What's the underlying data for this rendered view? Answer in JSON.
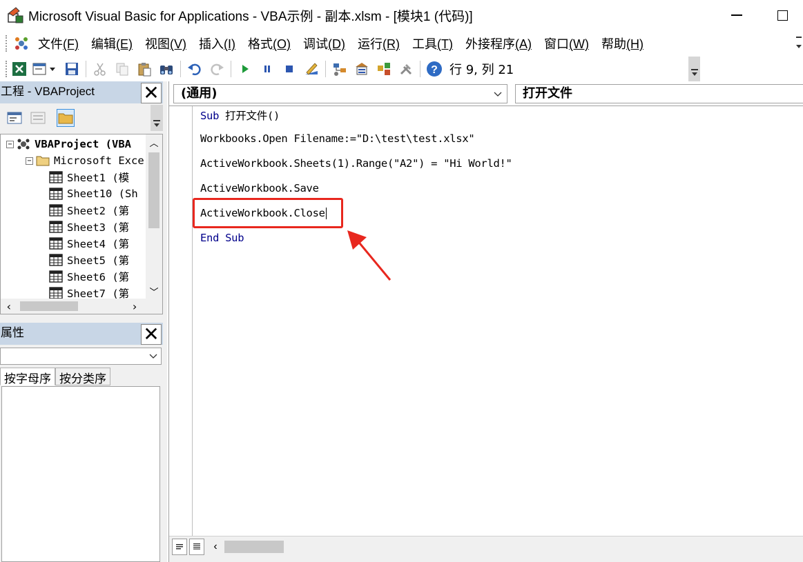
{
  "window": {
    "title": "Microsoft Visual Basic for Applications - VBA示例 - 副本.xlsm - [模块1 (代码)]"
  },
  "menu": [
    {
      "label": "文件",
      "key": "(F)"
    },
    {
      "label": "编辑",
      "key": "(E)"
    },
    {
      "label": "视图",
      "key": "(V)"
    },
    {
      "label": "插入",
      "key": "(I)"
    },
    {
      "label": "格式",
      "key": "(O)"
    },
    {
      "label": "调试",
      "key": "(D)"
    },
    {
      "label": "运行",
      "key": "(R)"
    },
    {
      "label": "工具",
      "key": "(T)"
    },
    {
      "label": "外接程序",
      "key": "(A)"
    },
    {
      "label": "窗口",
      "key": "(W)"
    },
    {
      "label": "帮助",
      "key": "(H)"
    }
  ],
  "toolbar": {
    "position_text": "行 9, 列 21"
  },
  "project_panel": {
    "title": "工程 - VBAProject",
    "tree": [
      {
        "label": "VBAProject (VBA",
        "level": 0,
        "toggle": "−",
        "bold": true
      },
      {
        "label": "Microsoft Exce",
        "level": 1,
        "toggle": "−",
        "bold": false
      },
      {
        "label": "Sheet1 (模",
        "level": 2,
        "bold": false
      },
      {
        "label": "Sheet10 (Sh",
        "level": 2,
        "bold": false
      },
      {
        "label": "Sheet2 (第",
        "level": 2,
        "bold": false
      },
      {
        "label": "Sheet3 (第",
        "level": 2,
        "bold": false
      },
      {
        "label": "Sheet4 (第",
        "level": 2,
        "bold": false
      },
      {
        "label": "Sheet5 (第",
        "level": 2,
        "bold": false
      },
      {
        "label": "Sheet6 (第",
        "level": 2,
        "bold": false
      },
      {
        "label": "Sheet7 (第",
        "level": 2,
        "bold": false
      }
    ]
  },
  "properties_panel": {
    "title": "属性",
    "tabs": [
      "按字母序",
      "按分类序"
    ],
    "active_tab": 0
  },
  "code_window": {
    "object_combo": "(通用)",
    "procedure_combo": "打开文件",
    "lines": [
      {
        "kw": "Sub",
        "text": " 打开文件()"
      },
      {
        "kw": "",
        "text": "Workbooks.Open Filename:=\"D:\\test\\test.xlsx\""
      },
      {
        "kw": "",
        "text": "ActiveWorkbook.Sheets(1).Range(\"A2\") = \"Hi World!\""
      },
      {
        "kw": "",
        "text": "ActiveWorkbook.Save"
      },
      {
        "kw": "",
        "text": "ActiveWorkbook.Close"
      },
      {
        "kw": "End Sub",
        "text": ""
      }
    ],
    "highlight_color": "#e8271e"
  }
}
